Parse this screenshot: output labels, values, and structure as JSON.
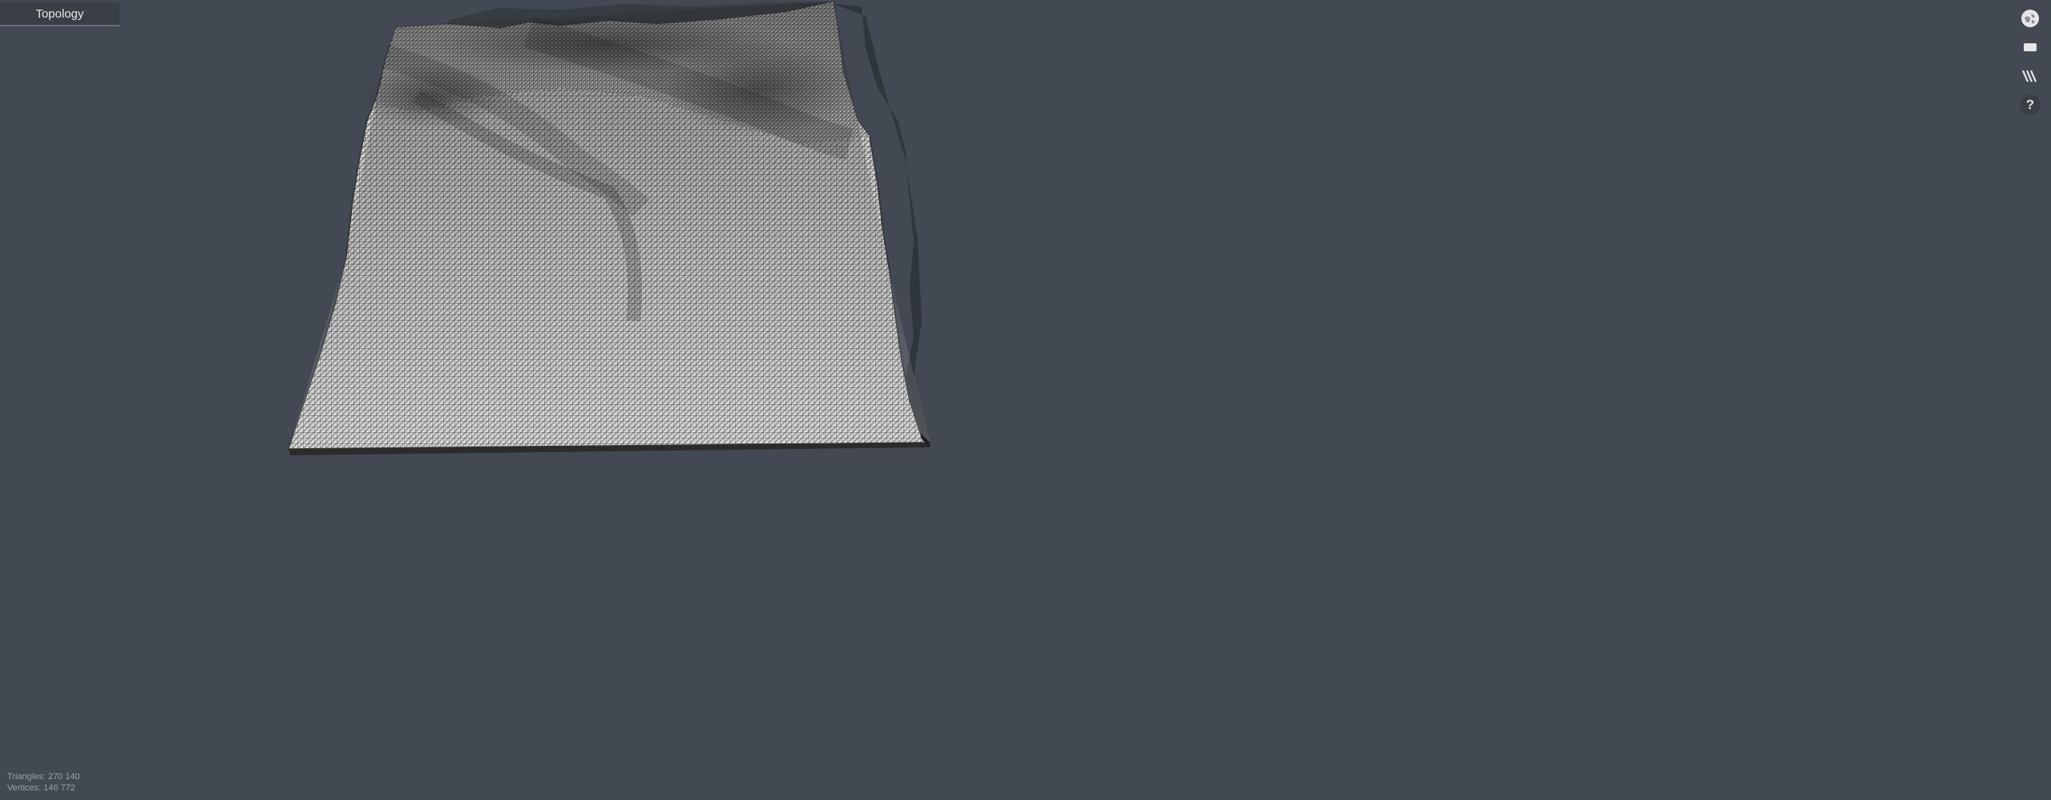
{
  "panel": {
    "title": "Topology"
  },
  "toolbar": {
    "tools": [
      {
        "icon": "globe-icon"
      },
      {
        "icon": "rectangle-icon"
      },
      {
        "icon": "layers-icon"
      },
      {
        "icon": "help-icon",
        "label": "?"
      }
    ]
  },
  "stats": {
    "triangles": "Triangles: 270 140",
    "vertices": "Vertices: 146 772"
  },
  "colors": {
    "background": "#434952",
    "mesh_light": "#d9d9d9",
    "mesh_dark": "#3c3c3c",
    "shadow": "#30353b"
  }
}
